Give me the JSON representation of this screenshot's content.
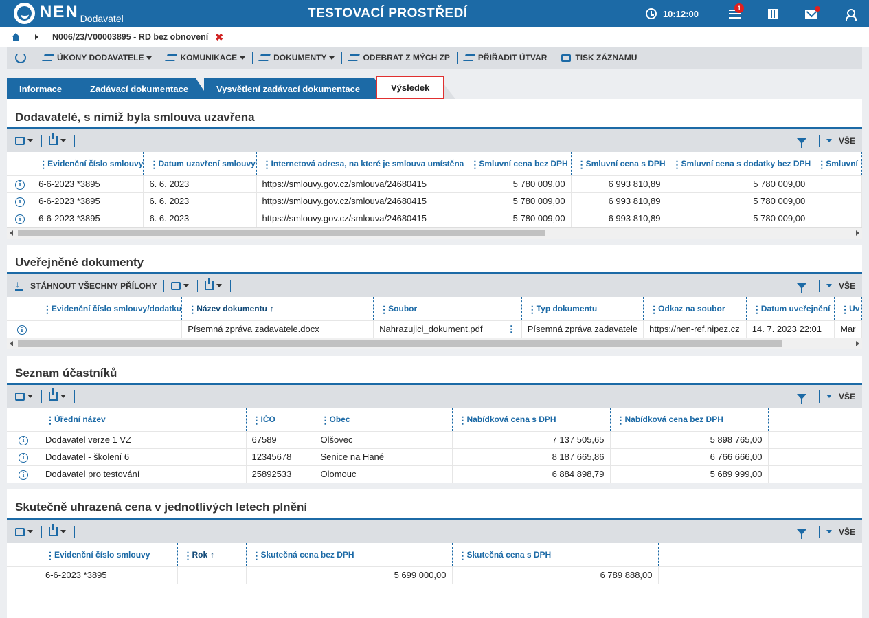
{
  "app": {
    "logo_text": "NEN",
    "logo_sub": "Dodavatel",
    "env_title": "TESTOVACÍ PROSTŘEDÍ",
    "time": "10:12:00",
    "notif_count": "1"
  },
  "breadcrumb": {
    "text": "N006/23/V00003895 - RD bez obnovení",
    "close": "✖"
  },
  "toolbar": {
    "items": [
      "ÚKONY DODAVATELE",
      "KOMUNIKACE",
      "DOKUMENTY",
      "ODEBRAT Z MÝCH ZP",
      "PŘIŘADIT ÚTVAR",
      "TISK ZÁZNAMU"
    ]
  },
  "tabs": [
    "Informace",
    "Zadávací dokumentace",
    "Vysvětlení zadávací dokumentace",
    "Výsledek"
  ],
  "common": {
    "all_label": "VŠE",
    "download_all": "STÁHNOUT VŠECHNY PŘÍLOHY"
  },
  "sec1": {
    "title": "Dodavatelé, s nimiž byla smlouva uzavřena",
    "headers": [
      "Evidenční číslo smlouvy",
      "Datum uzavření smlouvy",
      "Internetová adresa, na které je smlouva umístěna",
      "Smluvní cena bez DPH",
      "Smluvní cena s DPH",
      "Smluvní cena s dodatky bez DPH",
      "Smluvní"
    ],
    "rows": [
      [
        "6-6-2023 *3895",
        "6. 6. 2023",
        "https://smlouvy.gov.cz/smlouva/24680415",
        "5 780 009,00",
        "6 993 810,89",
        "5 780 009,00",
        ""
      ],
      [
        "6-6-2023 *3895",
        "6. 6. 2023",
        "https://smlouvy.gov.cz/smlouva/24680415",
        "5 780 009,00",
        "6 993 810,89",
        "5 780 009,00",
        ""
      ],
      [
        "6-6-2023 *3895",
        "6. 6. 2023",
        "https://smlouvy.gov.cz/smlouva/24680415",
        "5 780 009,00",
        "6 993 810,89",
        "5 780 009,00",
        ""
      ]
    ]
  },
  "sec2": {
    "title": "Uveřejněné dokumenty",
    "headers": [
      "Evidenční číslo smlouvy/dodatku",
      "Název dokumentu",
      "Soubor",
      "Typ dokumentu",
      "Odkaz na soubor",
      "Datum uveřejnění",
      "Uv"
    ],
    "rows": [
      [
        "",
        "Písemná zpráva zadavatele.docx",
        "Nahrazujici_dokument.pdf",
        "Písemná zpráva zadavatele",
        "https://nen-ref.nipez.cz",
        "14. 7. 2023 22:01",
        "Mar"
      ]
    ]
  },
  "sec3": {
    "title": "Seznam účastníků",
    "headers": [
      "Úřední název",
      "IČO",
      "Obec",
      "Nabídková cena s DPH",
      "Nabídková cena bez DPH"
    ],
    "rows": [
      [
        "Dodavatel verze 1 VZ",
        "67589",
        "Olšovec",
        "7 137 505,65",
        "5 898 765,00"
      ],
      [
        "Dodavatel - školení 6",
        "12345678",
        "Senice na Hané",
        "8 187 665,86",
        "6 766 666,00"
      ],
      [
        "Dodavatel pro testování",
        "25892533",
        "Olomouc",
        "6 884 898,79",
        "5 689 999,00"
      ]
    ]
  },
  "sec4": {
    "title": "Skutečně uhrazená cena v jednotlivých letech plnění",
    "headers": [
      "Evidenční číslo smlouvy",
      "Rok",
      "Skutečná cena bez DPH",
      "Skutečná cena s DPH"
    ],
    "rows": [
      [
        "6-6-2023 *3895",
        "",
        "5 699 000,00",
        "6 789 888,00"
      ]
    ]
  }
}
